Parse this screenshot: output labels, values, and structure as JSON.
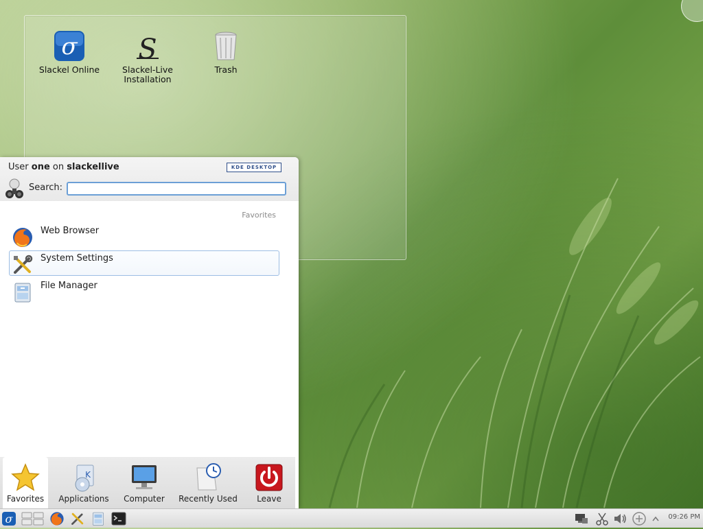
{
  "desktop": {
    "icons": [
      {
        "label": "Slackel Online",
        "icon": "slackel-online-icon"
      },
      {
        "label": "Slackel-Live\nInstallation",
        "icon": "slackel-install-icon"
      },
      {
        "label": "Trash",
        "icon": "trash-icon"
      }
    ]
  },
  "kickoff": {
    "user_prefix": "User ",
    "user_name": "one",
    "user_mid": " on ",
    "host": "slackellive",
    "badge": "KDE DESKTOP",
    "search_label": "Search:",
    "search_value": "",
    "section_title": "Favorites",
    "favorites": [
      {
        "name": "Web Browser",
        "icon": "firefox-icon"
      },
      {
        "name": "System Settings",
        "icon": "settings-tools-icon"
      },
      {
        "name": "File Manager",
        "icon": "file-manager-icon"
      }
    ],
    "tabs": [
      {
        "label": "Favorites",
        "icon": "star-icon",
        "active": true
      },
      {
        "label": "Applications",
        "icon": "applications-icon",
        "active": false
      },
      {
        "label": "Computer",
        "icon": "computer-icon",
        "active": false
      },
      {
        "label": "Recently Used",
        "icon": "clock-icon",
        "active": false
      },
      {
        "label": "Leave",
        "icon": "power-icon",
        "active": false
      }
    ]
  },
  "taskbar": {
    "clock": "09:26 PM",
    "launchers": [
      "slackel-launcher-icon",
      "pager-icon",
      "firefox-icon",
      "settings-tools-icon",
      "file-manager-icon",
      "terminal-icon"
    ],
    "tray": [
      "network-icon",
      "clipboard-scissors-icon",
      "volume-icon",
      "update-icon",
      "tray-expand-icon"
    ]
  }
}
